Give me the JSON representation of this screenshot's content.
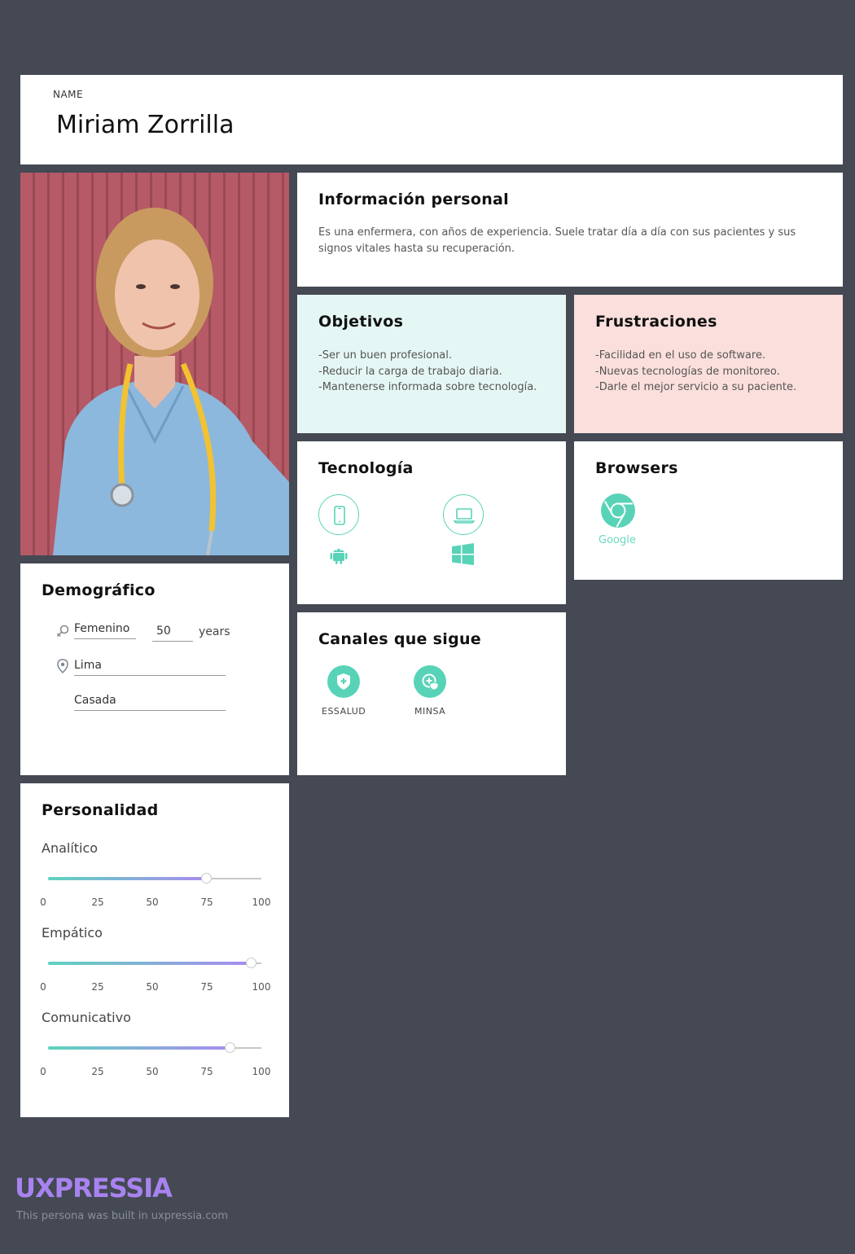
{
  "name_section": {
    "label": "NAME",
    "value": "Miriam Zorrilla"
  },
  "info": {
    "title": "Información personal",
    "text": "Es una enfermera, con años de experiencia. Suele tratar día a día con sus pacientes y sus signos vitales hasta su recuperación."
  },
  "goals": {
    "title": "Objetivos",
    "items": [
      "-Ser un buen profesional.",
      "-Reducir la carga de trabajo diaria.",
      "-Mantenerse informada sobre tecnología."
    ]
  },
  "frustrations": {
    "title": "Frustraciones",
    "items": [
      "-Facilidad en el uso de software.",
      "-Nuevas tecnologías de monitoreo.",
      "-Darle el mejor servicio a su paciente."
    ]
  },
  "tech": {
    "title": "Tecnología",
    "icons": [
      "smartphone-icon",
      "laptop-icon",
      "android-icon",
      "windows-icon"
    ]
  },
  "browsers": {
    "title": "Browsers",
    "items": [
      {
        "label": "Google",
        "icon": "chrome-icon"
      }
    ]
  },
  "demo": {
    "title": "Demográfico",
    "gender": "Femenino",
    "age": "50",
    "age_unit": "years",
    "city": "Lima",
    "civil_status": "Casada"
  },
  "channels": {
    "title": "Canales que sigue",
    "items": [
      {
        "label": "ESSALUD",
        "icon": "shield-plus-icon"
      },
      {
        "label": "MINSA",
        "icon": "medical-shield-icon"
      }
    ]
  },
  "personality": {
    "title": "Personalidad",
    "ticks": [
      "0",
      "25",
      "50",
      "75",
      "100"
    ],
    "traits": [
      {
        "label": "Analítico",
        "value": 74
      },
      {
        "label": "Empático",
        "value": 95
      },
      {
        "label": "Comunicativo",
        "value": 85
      }
    ]
  },
  "footer": {
    "brand": "UXPRESSIA",
    "note": "This persona was built in uxpressia.com"
  },
  "colors": {
    "background": "#444953",
    "accent": "#59d3b8",
    "goals_bg": "#e5f7f4",
    "frustrations_bg": "#fadfdc",
    "brand": "#a883f0"
  }
}
